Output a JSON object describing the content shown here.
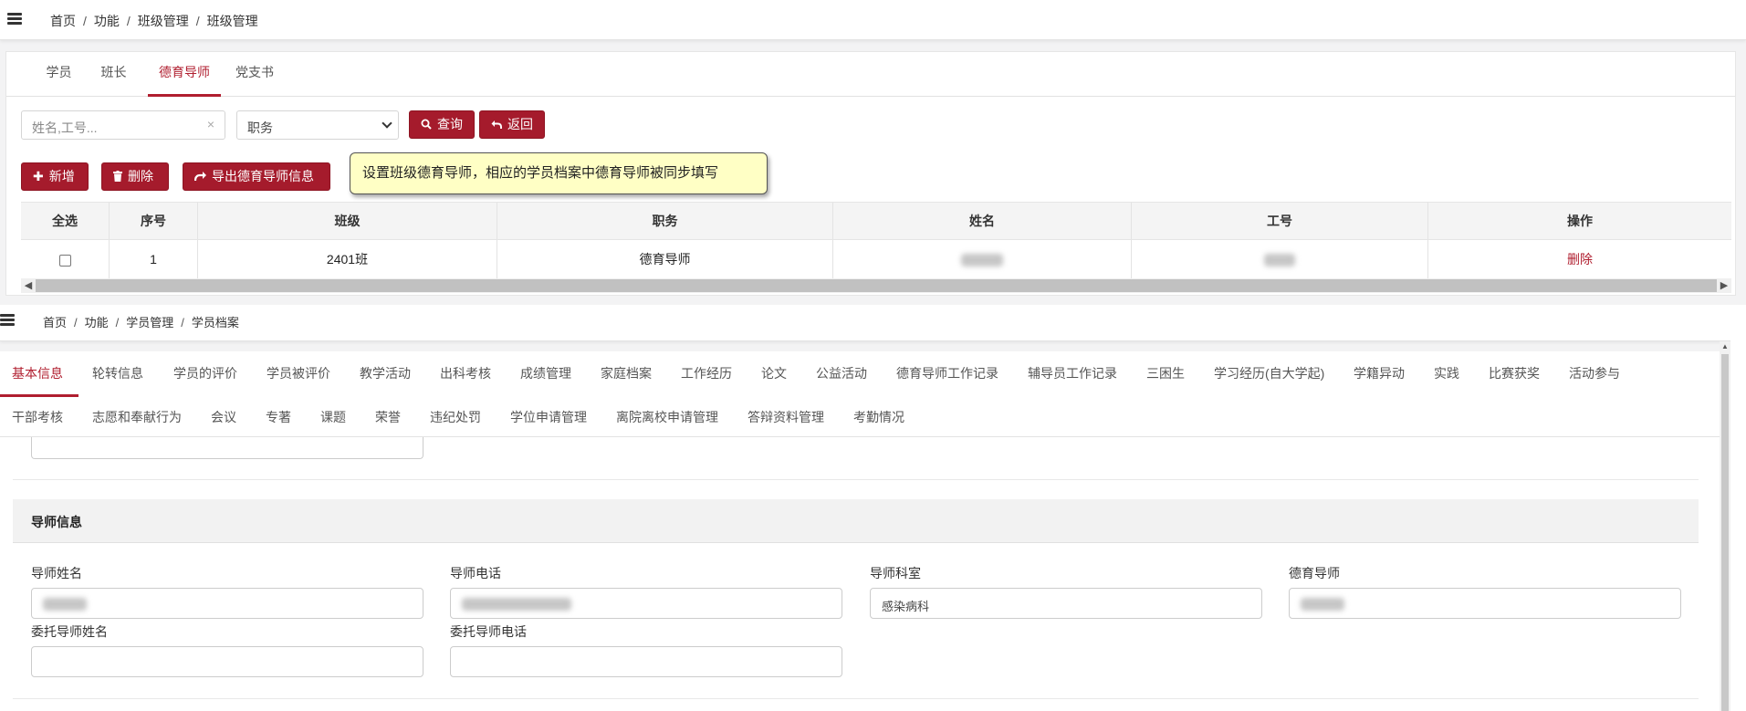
{
  "top": {
    "breadcrumb": [
      "首页",
      "功能",
      "班级管理",
      "班级管理"
    ],
    "tabs": [
      {
        "label": "学员",
        "active": false
      },
      {
        "label": "班长",
        "active": false
      },
      {
        "label": "德育导师",
        "active": true
      },
      {
        "label": "党支书",
        "active": false
      }
    ],
    "search": {
      "placeholder": "姓名,工号...",
      "clear_icon": "×"
    },
    "select": {
      "value": "职务"
    },
    "buttons": {
      "query": "查询",
      "back": "返回",
      "add": "新增",
      "delete": "删除",
      "export": "导出德育导师信息"
    },
    "tooltip": "设置班级德育导师，相应的学员档案中德育导师被同步填写",
    "table": {
      "headers": [
        "全选",
        "序号",
        "班级",
        "职务",
        "姓名",
        "工号",
        "操作"
      ],
      "rows": [
        {
          "index": "1",
          "class": "2401班",
          "role": "德育导师",
          "name": "",
          "job_no": "",
          "action": "删除"
        }
      ]
    }
  },
  "bottom": {
    "breadcrumb": [
      "首页",
      "功能",
      "学员管理",
      "学员档案"
    ],
    "tabs_row1": [
      "基本信息",
      "轮转信息",
      "学员的评价",
      "学员被评价",
      "教学活动",
      "出科考核",
      "成绩管理",
      "家庭档案",
      "工作经历",
      "论文",
      "公益活动",
      "德育导师工作记录",
      "辅导员工作记录",
      "三困生",
      "学习经历(自大学起)",
      "学籍异动",
      "实践",
      "比赛获奖",
      "活动参与"
    ],
    "tabs_row2": [
      "干部考核",
      "志愿和奉献行为",
      "会议",
      "专著",
      "课题",
      "荣誉",
      "违纪处罚",
      "学位申请管理",
      "离院离校申请管理",
      "答辩资料管理",
      "考勤情况"
    ],
    "active_tab": "基本信息",
    "section_title": "导师信息",
    "fields": {
      "mentor_name_label": "导师姓名",
      "mentor_phone_label": "导师电话",
      "mentor_dept_label": "导师科室",
      "mentor_dept_value": "感染病科",
      "moral_mentor_label": "德育导师",
      "proxy_name_label": "委托导师姓名",
      "proxy_phone_label": "委托导师电话"
    }
  },
  "colors": {
    "accent": "#a51b2c",
    "tooltip_bg": "#ffffc5"
  }
}
